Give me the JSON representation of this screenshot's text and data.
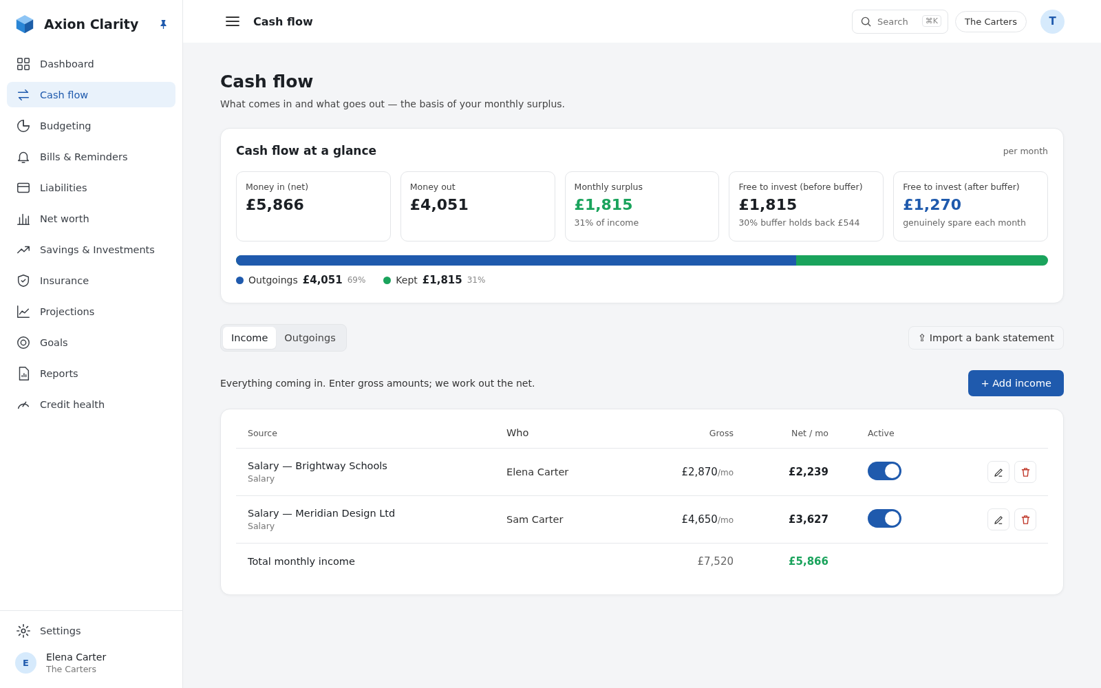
{
  "app": {
    "name": "Axion Clarity"
  },
  "sidebar": {
    "items": [
      {
        "label": "Dashboard",
        "selected": false
      },
      {
        "label": "Cash flow",
        "selected": true
      },
      {
        "label": "Budgeting",
        "selected": false
      },
      {
        "label": "Bills & Reminders",
        "selected": false
      },
      {
        "label": "Liabilities",
        "selected": false
      },
      {
        "label": "Net worth",
        "selected": false
      },
      {
        "label": "Savings & Investments",
        "selected": false
      },
      {
        "label": "Insurance",
        "selected": false
      },
      {
        "label": "Projections",
        "selected": false
      },
      {
        "label": "Goals",
        "selected": false
      },
      {
        "label": "Reports",
        "selected": false
      },
      {
        "label": "Credit health",
        "selected": false
      }
    ],
    "settings": "Settings",
    "user": {
      "initial": "E",
      "name": "Elena Carter",
      "household": "The Carters"
    }
  },
  "topbar": {
    "title": "Cash flow",
    "search": {
      "placeholder": "Search",
      "shortcut": "⌘K"
    },
    "household": "The Carters",
    "avatar": "T"
  },
  "page": {
    "title": "Cash flow",
    "subtitle": "What comes in and what goes out — the basis of your monthly surplus."
  },
  "glance": {
    "title": "Cash flow at a glance",
    "period": "per month",
    "stats": [
      {
        "label": "Money in (net)",
        "value": "£5,866",
        "kind": "plain"
      },
      {
        "label": "Money out",
        "value": "£4,051",
        "kind": "plain"
      },
      {
        "label": "Monthly surplus",
        "value": "£1,815",
        "kind": "positive",
        "note": "31% of income"
      },
      {
        "label": "Free to invest (before buffer)",
        "value": "£1,815",
        "kind": "plain",
        "note": "30% buffer holds back £544"
      },
      {
        "label": "Free to invest (after buffer)",
        "value": "£1,270",
        "kind": "accent",
        "note": "genuinely spare each month"
      }
    ],
    "bar": {
      "level": 0.69
    },
    "legend": [
      {
        "label": "Outgoings",
        "amount": "£4,051",
        "share": "69%",
        "color": "#1f5aad"
      },
      {
        "label": "Kept",
        "amount": "£1,815",
        "share": "31%",
        "color": "#1aa35c"
      }
    ]
  },
  "tabs": [
    {
      "label": "Income",
      "selected": true
    },
    {
      "label": "Outgoings",
      "selected": false
    }
  ],
  "import_button": "⇪ Import a bank statement",
  "hint": "Everything coming in. Enter gross amounts; we work out the net.",
  "add_button": "+ Add income",
  "table": {
    "columns": [
      "Source",
      "Who",
      "Gross",
      "Net / mo",
      "Active"
    ],
    "rows": [
      {
        "source": "Salary — Brightway Schools",
        "type": "Salary",
        "who": "Elena Carter",
        "gross": "£2,870",
        "unit": "/mo",
        "net": "£2,239",
        "active": true
      },
      {
        "source": "Salary — Meridian Design Ltd",
        "type": "Salary",
        "who": "Sam Carter",
        "gross": "£4,650",
        "unit": "/mo",
        "net": "£3,627",
        "active": true
      }
    ],
    "total": {
      "label": "Total monthly income",
      "gross": "£7,520",
      "net": "£5,866"
    }
  }
}
